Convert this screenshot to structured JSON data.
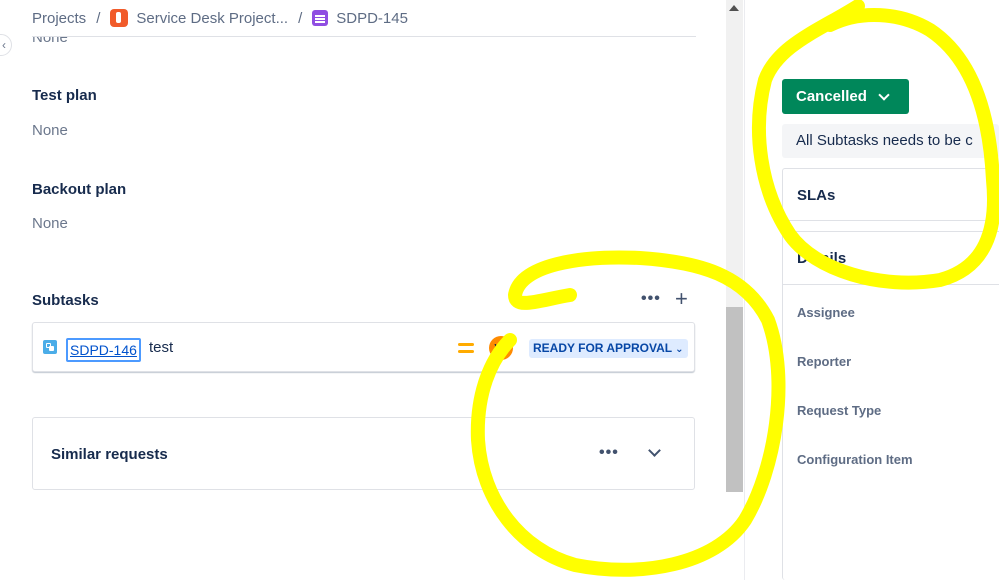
{
  "breadcrumb": {
    "projects": "Projects",
    "project_name": "Service Desk Project...",
    "issue_key": "SDPD-145"
  },
  "top_field_value": "None",
  "fields": [
    {
      "label": "Test plan",
      "value": "None"
    },
    {
      "label": "Backout plan",
      "value": "None"
    }
  ],
  "subtasks": {
    "title": "Subtasks",
    "items": [
      {
        "key": "SDPD-146",
        "summary": "test",
        "assignee_initials": "VS",
        "status": "READY FOR APPROVAL"
      }
    ]
  },
  "similar_requests": {
    "title": "Similar requests"
  },
  "status_button": {
    "label": "Cancelled"
  },
  "notice": "All Subtasks needs to be c",
  "slas": {
    "title": "SLAs"
  },
  "details": {
    "title": "Details",
    "labels": [
      "Assignee",
      "Reporter",
      "Request Type",
      "Configuration Item"
    ]
  },
  "colors": {
    "status_green": "#00875a",
    "lozenge_blue": "#deebff",
    "priority_medium": "#ffab00",
    "avatar_orange": "#ff8b00",
    "highlight_yellow": "#ffff00"
  }
}
